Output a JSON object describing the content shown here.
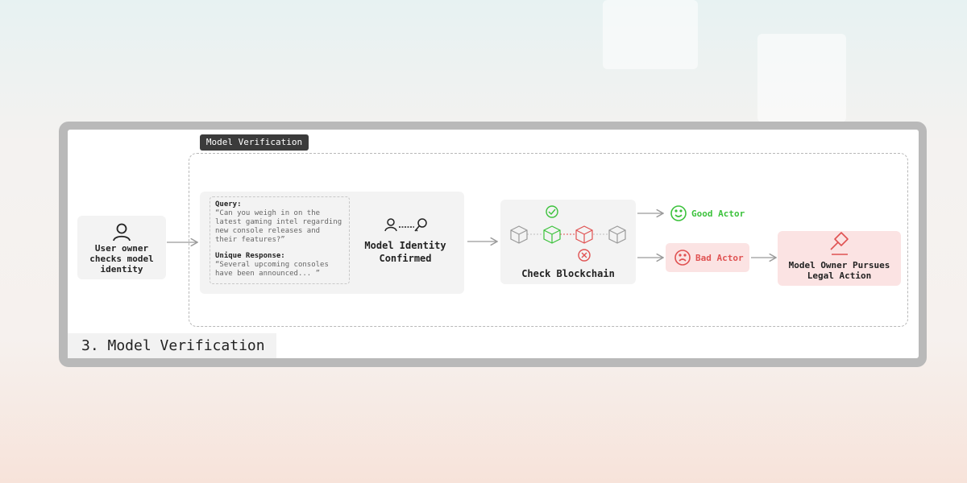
{
  "section_tag": "Model Verification",
  "footer_title": "3. Model Verification",
  "user_card": {
    "icon": "user-icon",
    "label_lines": [
      "User owner",
      "checks model",
      "identity"
    ]
  },
  "query": {
    "query_label": "Query:",
    "query_lines": [
      "“Can you weigh in on the",
      "latest gaming intel regarding",
      "new console releases and",
      "their features?”"
    ],
    "response_label": "Unique Response:",
    "response_lines": [
      "“Several upcoming consoles",
      "have been announced... ”"
    ]
  },
  "identity": {
    "icons": [
      "user-icon",
      "key-icon"
    ],
    "label_lines": [
      "Model Identity",
      "Confirmed"
    ]
  },
  "blockchain": {
    "label": "Check Blockchain",
    "icons": [
      "check-circle-icon",
      "x-circle-icon",
      "cube-icon"
    ],
    "colors": {
      "neutral": "#9a9a9a",
      "good": "#3cc23c",
      "bad": "#e05252"
    }
  },
  "good_actor": {
    "label": "Good Actor",
    "icon": "smile-icon",
    "color": "#3cc23c"
  },
  "bad_actor": {
    "label": "Bad Actor",
    "icon": "frown-icon",
    "color": "#e05252"
  },
  "legal": {
    "icon": "gavel-icon",
    "label_lines": [
      "Model Owner Pursues",
      "Legal Action"
    ]
  }
}
